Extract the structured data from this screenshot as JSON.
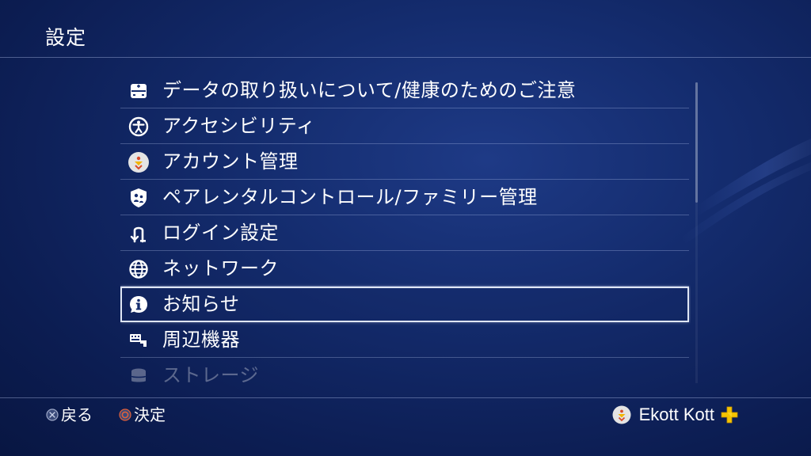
{
  "page": {
    "title": "設定"
  },
  "colors": {
    "background_top": "#1e3a86",
    "background_bottom": "#081642",
    "selection_border": "#dfe6f5",
    "plus_gold": "#f5c400",
    "circle_button": "#e0603a",
    "cross_button": "#9ea8c8"
  },
  "menu": {
    "items": [
      {
        "label": "データの取り扱いについて/健康のためのご注意",
        "icon": "gamepad-icon"
      },
      {
        "label": "アクセシビリティ",
        "icon": "accessibility-icon"
      },
      {
        "label": "アカウント管理",
        "icon": "avatar-icon"
      },
      {
        "label": "ペアレンタルコントロール/ファミリー管理",
        "icon": "family-icon"
      },
      {
        "label": "ログイン設定",
        "icon": "login-icon"
      },
      {
        "label": "ネットワーク",
        "icon": "globe-icon"
      },
      {
        "label": "お知らせ",
        "icon": "info-icon"
      },
      {
        "label": "周辺機器",
        "icon": "keyboard-icon"
      },
      {
        "label": "ストレージ",
        "icon": "storage-icon"
      }
    ],
    "selected_index": 6
  },
  "footer": {
    "back_label": "戻る",
    "ok_label": "決定",
    "user_name": "Ekott Kott"
  }
}
